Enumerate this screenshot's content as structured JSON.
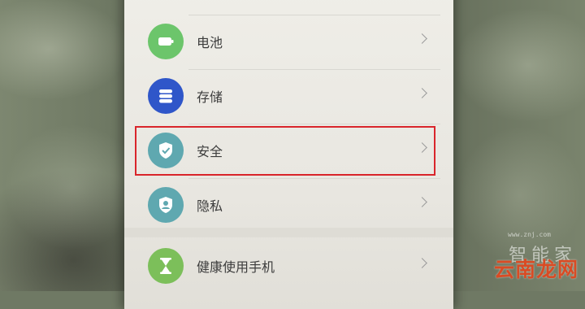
{
  "settings": {
    "items": [
      {
        "label": "电池",
        "icon": "battery-icon",
        "color": "#6cc56b"
      },
      {
        "label": "存储",
        "icon": "storage-icon",
        "color": "#2f56c9"
      },
      {
        "label": "安全",
        "icon": "shield-check-icon",
        "color": "#5fa8b0"
      },
      {
        "label": "隐私",
        "icon": "privacy-icon",
        "color": "#5fa8b0"
      },
      {
        "label": "健康使用手机",
        "icon": "hourglass-icon",
        "color": "#7cbf5a"
      }
    ]
  },
  "highlight": {
    "target": "安全",
    "color": "#d9252b"
  },
  "watermark": {
    "top": "智能家",
    "url": "www.znj.com",
    "bottom": "云南龙网"
  }
}
